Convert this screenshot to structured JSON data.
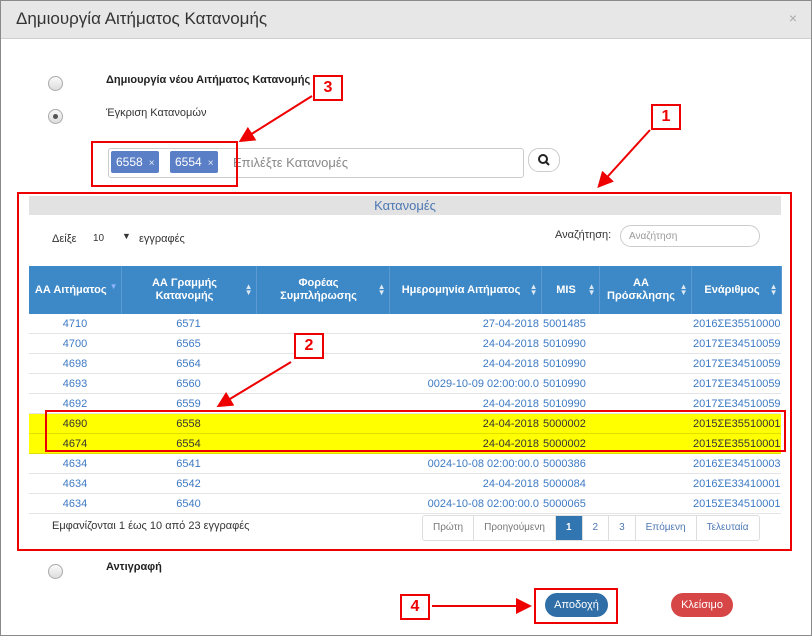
{
  "dialog": {
    "title": "Δημιουργία Αιτήματος Κατανομής",
    "close_symbol": "×"
  },
  "options": {
    "create_new": "Δημιουργία νέου Αιτήματος Κατανομής",
    "approve_allocations": "Έγκριση Κατανομών",
    "copy": "Αντιγραφή",
    "selected": "approve_allocations"
  },
  "tag_input": {
    "tags": [
      {
        "label": "6558",
        "remove": "×"
      },
      {
        "label": "6554",
        "remove": "×"
      }
    ],
    "placeholder": "Επιλέξτε Κατανομές"
  },
  "search_button_icon": "search-icon",
  "panel": {
    "title": "Κατανομές",
    "length_prefix": "Δείξε",
    "length_value": "10",
    "length_suffix": "εγγραφές",
    "search_label": "Αναζήτηση:",
    "search_placeholder": "Αναζήτηση"
  },
  "table": {
    "headers": [
      "ΑΑ Αιτήματος",
      "ΑΑ Γραμμής Κατανομής",
      "Φορέας Συμπλήρωσης",
      "Ημερομηνία Αιτήματος",
      "MIS",
      "ΑΑ Πρόσκλησης",
      "Ενάριθμος"
    ],
    "rows": [
      [
        "4710",
        "6571",
        "",
        "27-04-2018",
        "5001485",
        "",
        "2016ΣΕ35510000"
      ],
      [
        "4700",
        "6565",
        "",
        "24-04-2018",
        "5010990",
        "",
        "2017ΣΕ34510059"
      ],
      [
        "4698",
        "6564",
        "",
        "24-04-2018",
        "5010990",
        "",
        "2017ΣΕ34510059"
      ],
      [
        "4693",
        "6560",
        "",
        "0029-10-09 02:00:00.0",
        "5010990",
        "",
        "2017ΣΕ34510059"
      ],
      [
        "4692",
        "6559",
        "",
        "24-04-2018",
        "5010990",
        "",
        "2017ΣΕ34510059"
      ],
      [
        "4690",
        "6558",
        "",
        "24-04-2018",
        "5000002",
        "",
        "2015ΣΕ35510001"
      ],
      [
        "4674",
        "6554",
        "",
        "24-04-2018",
        "5000002",
        "",
        "2015ΣΕ35510001"
      ],
      [
        "4634",
        "6541",
        "",
        "0024-10-08 02:00:00.0",
        "5000386",
        "",
        "2016ΣΕ34510003"
      ],
      [
        "4634",
        "6542",
        "",
        "24-04-2018",
        "5000084",
        "",
        "2016ΣΕ33410001"
      ],
      [
        "4634",
        "6540",
        "",
        "0024-10-08 02:00:00.0",
        "5000065",
        "",
        "2015ΣΕ34510001"
      ]
    ],
    "highlighted_rows": [
      5,
      6
    ]
  },
  "info": "Εμφανίζονται 1 έως 10 από 23 εγγραφές",
  "pagination": {
    "first": "Πρώτη",
    "previous": "Προηγούμενη",
    "pages": [
      "1",
      "2",
      "3"
    ],
    "active_page": "1",
    "next": "Επόμενη",
    "last": "Τελευταία"
  },
  "buttons": {
    "approve": "Αποδοχή",
    "close": "Κλείσιμο"
  },
  "callouts": [
    "1",
    "2",
    "3",
    "4"
  ],
  "colors": {
    "header_blue": "#3d88c6",
    "highlight": "#ffff00",
    "annotation_red": "#ee0000",
    "approve": "#2f6ea7",
    "close": "#d64646"
  }
}
